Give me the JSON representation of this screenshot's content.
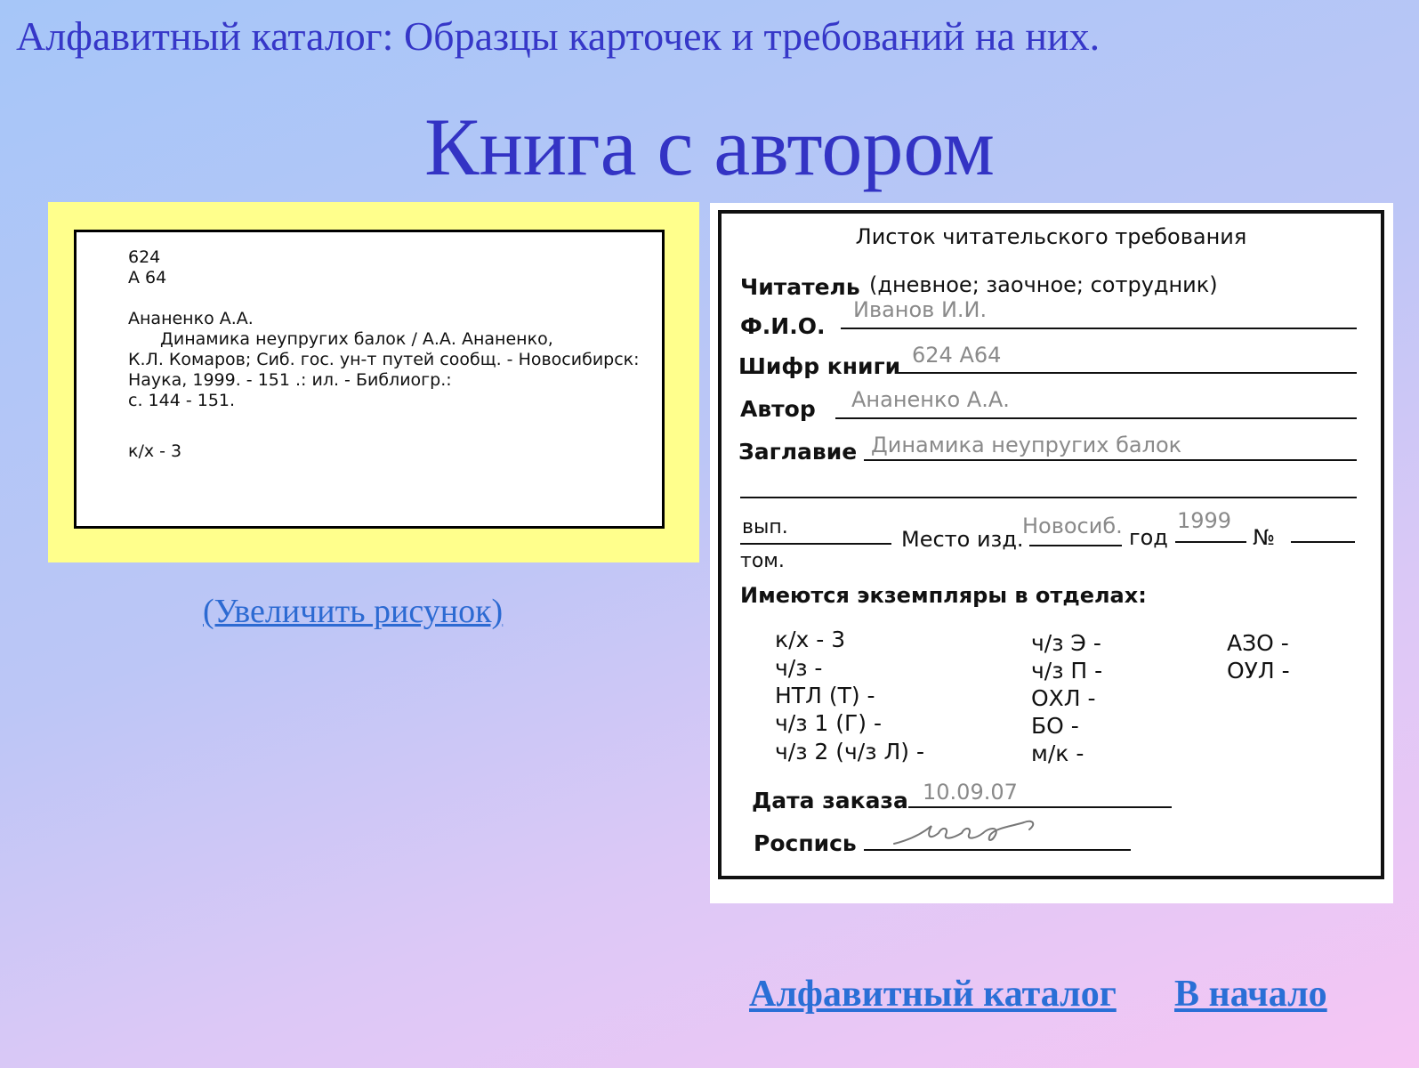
{
  "header": "Алфавитный каталог: Образцы карточек и требований на них.",
  "title": "Книга с автором",
  "card": {
    "shelf": "624",
    "author_mark": "А 64",
    "heading": "Ананенко А.А.",
    "line1": "Динамика неупругих балок  /  А.А. Ананенко,",
    "line2": "К.Л. Комаров; Сиб. гос. ун-т путей сообщ. - Новосибирск:",
    "line3": "Наука, 1999. - 151 .: ил. - Библиогр.:",
    "line4": "с. 144 - 151.",
    "location": "к/х - 3"
  },
  "enlarge_link": "(Увеличить рисунок)",
  "slip": {
    "title": "Листок читательского требования",
    "reader_label": "Читатель",
    "reader_options": "(дневное; заочное; сотрудник)",
    "fio_label": "Ф.И.О.",
    "fio_value": "Иванов И.И.",
    "cipher_label": "Шифр книги",
    "cipher_value": "624 А64",
    "author_label": "Автор",
    "author_value": "Ананенко А.А.",
    "title_label": "Заглавие",
    "title_value": "Динамика неупругих балок",
    "issue_label": "вып.",
    "volume_label": "том.",
    "place_label": "Место изд.",
    "place_value": "Новосиб.",
    "year_label": "год",
    "year_value": "1999",
    "number_label": "№",
    "copies_label": "Имеются экземпляры в отделах:",
    "dept_col1": [
      "к/х - 3",
      "ч/з -",
      "НТЛ (Т) -",
      "ч/з 1 (Г) -",
      "ч/з 2 (ч/з Л) -"
    ],
    "dept_col2": [
      "ч/з Э -",
      "ч/з П -",
      "ОХЛ -",
      "БО -",
      "м/к -"
    ],
    "dept_col3": [
      "АЗО -",
      "ОУЛ -"
    ],
    "date_label": "Дата заказа",
    "date_value": "10.09.07",
    "signature_label": "Роспись"
  },
  "nav": {
    "catalog": "Алфавитный каталог",
    "home": "В начало"
  }
}
